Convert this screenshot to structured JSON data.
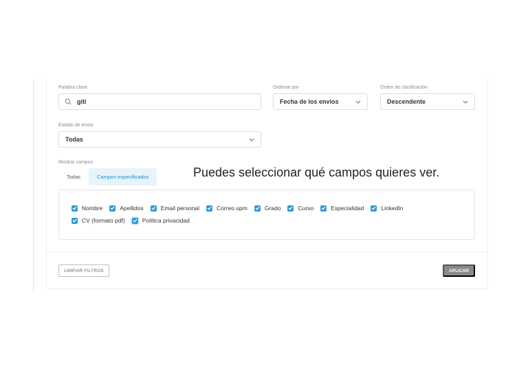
{
  "filters": {
    "keyword": {
      "label": "Palabra clave",
      "value": "giti",
      "icon": "search-icon"
    },
    "order_by": {
      "label": "Ordenar por",
      "value": "Fecha de los envíos"
    },
    "sort_order": {
      "label": "Orden de clasificación",
      "value": "Descendente"
    },
    "submission_state": {
      "label": "Estado de envío",
      "value": "Todas"
    }
  },
  "show_fields": {
    "label": "Mostrar campos",
    "tabs": [
      {
        "label": "Todas",
        "active": false
      },
      {
        "label": "Campos especificados",
        "active": true
      }
    ],
    "checkboxes": [
      {
        "label": "Nombre",
        "checked": true
      },
      {
        "label": "Apellidos",
        "checked": true
      },
      {
        "label": "Email personal",
        "checked": true
      },
      {
        "label": "Correo upm",
        "checked": true
      },
      {
        "label": "Grado",
        "checked": true
      },
      {
        "label": "Curso",
        "checked": true
      },
      {
        "label": "Especialidad",
        "checked": true
      },
      {
        "label": "LinkedIn",
        "checked": true
      },
      {
        "label": "CV (formato pdf)",
        "checked": true
      },
      {
        "label": "Política privacidad",
        "checked": true
      }
    ]
  },
  "tooltip": "Puedes seleccionar qué campos quieres ver.",
  "actions": {
    "clear_label": "LIMPIAR FILTROS",
    "apply_label": "APLICAR"
  },
  "colors": {
    "accent": "#2e9ad8",
    "active_tab_bg": "#e8f4fb",
    "apply_bg": "#8a8a8a"
  }
}
